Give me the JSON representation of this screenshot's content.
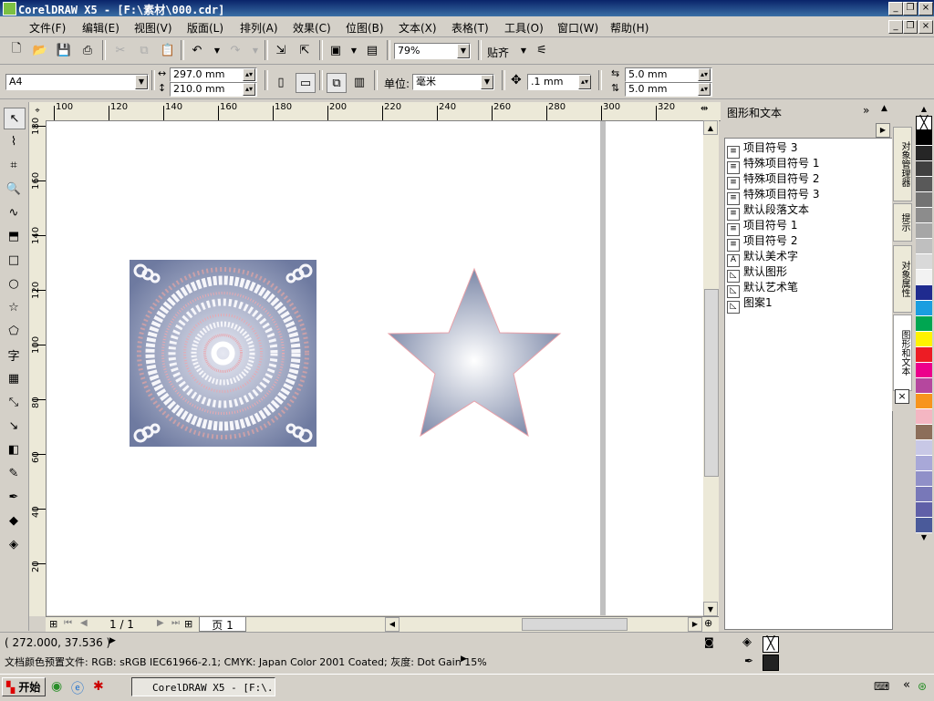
{
  "window": {
    "title": "CorelDRAW X5 - [F:\\素材\\000.cdr]"
  },
  "menu": [
    "文件(F)",
    "编辑(E)",
    "视图(V)",
    "版面(L)",
    "排列(A)",
    "效果(C)",
    "位图(B)",
    "文本(X)",
    "表格(T)",
    "工具(O)",
    "窗口(W)",
    "帮助(H)"
  ],
  "toolbar": {
    "zoom": "79%",
    "snap_label": "贴齐"
  },
  "props": {
    "page_size": "A4",
    "width": "297.0 mm",
    "height": "210.0 mm",
    "unit_label": "单位:",
    "unit_value": "毫米",
    "nudge": ".1 mm",
    "dup_x": "5.0 mm",
    "dup_y": "5.0 mm"
  },
  "ruler": {
    "top": [
      "100",
      "120",
      "140",
      "160",
      "180",
      "200",
      "220",
      "240",
      "260",
      "280",
      "300",
      "320"
    ],
    "left": [
      "180",
      "160",
      "140",
      "120",
      "100",
      "80",
      "60",
      "40",
      "20"
    ]
  },
  "page_nav": {
    "counter": "1 / 1",
    "page_tab": "页 1"
  },
  "docker": {
    "title": "图形和文本",
    "items": [
      {
        "icon": "paragraph-style-icon",
        "label": "项目符号 3"
      },
      {
        "icon": "paragraph-style-icon",
        "label": "特殊项目符号 1"
      },
      {
        "icon": "paragraph-style-icon",
        "label": "特殊项目符号 2"
      },
      {
        "icon": "paragraph-style-icon",
        "label": "特殊项目符号 3"
      },
      {
        "icon": "paragraph-style-icon",
        "label": "默认段落文本"
      },
      {
        "icon": "paragraph-style-icon",
        "label": "项目符号 1"
      },
      {
        "icon": "paragraph-style-icon",
        "label": "项目符号 2"
      },
      {
        "icon": "artistic-text-icon",
        "label": "默认美术字"
      },
      {
        "icon": "graphic-style-icon",
        "label": "默认图形"
      },
      {
        "icon": "graphic-style-icon",
        "label": "默认艺术笔"
      },
      {
        "icon": "graphic-style-icon",
        "label": "图案1"
      }
    ],
    "side_tabs": [
      "对象管理器",
      "提示",
      "对象属性",
      "图形和文本"
    ]
  },
  "palette": [
    "#ffffff",
    "#000000",
    "#262626",
    "#404040",
    "#595959",
    "#737373",
    "#8c8c8c",
    "#a6a6a6",
    "#bfbfbf",
    "#d9d9d9",
    "#f2f2f2",
    "#1f2b8f",
    "#1a9ee0",
    "#00a651",
    "#fff200",
    "#ed1c24",
    "#ec008c",
    "#b5479e",
    "#f7941d",
    "#f4b6c2",
    "#8c6e5a",
    "#c8c8e6",
    "#a8a8d8",
    "#9090c8",
    "#7878b8",
    "#6060a8",
    "#4a5a9a"
  ],
  "status": {
    "coords": "( 272.000, 37.536 )",
    "profile": "文档颜色预置文件: RGB: sRGB IEC61966-2.1; CMYK: Japan Color 2001 Coated; 灰度: Dot Gain 15%"
  },
  "taskbar": {
    "start": "开始",
    "task": "CorelDRAW X5 - [F:\\..."
  }
}
